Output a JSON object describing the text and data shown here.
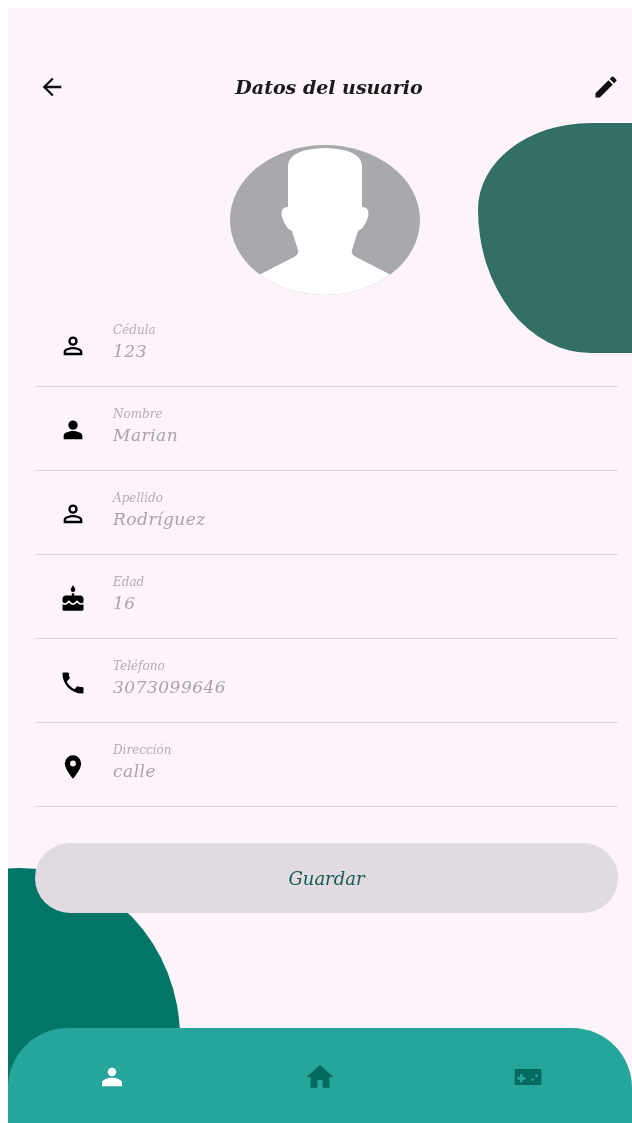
{
  "app_bar": {
    "title": "Datos del usuario"
  },
  "fields": [
    {
      "kind": "person-outline",
      "label": "Cédula",
      "value": "123"
    },
    {
      "kind": "person",
      "label": "Nombre",
      "value": "Marian"
    },
    {
      "kind": "person-outline",
      "label": "Apellido",
      "value": "Rodríguez"
    },
    {
      "kind": "cake",
      "label": "Edad",
      "value": "16"
    },
    {
      "kind": "phone",
      "label": "Teléfono",
      "value": "3073099646"
    },
    {
      "kind": "place",
      "label": "Dirección",
      "value": "calle"
    }
  ],
  "save_button": {
    "label": "Guardar"
  },
  "bottom_nav": [
    {
      "kind": "person",
      "selected": true
    },
    {
      "kind": "home",
      "selected": false
    },
    {
      "kind": "gamepad",
      "selected": false
    }
  ]
}
